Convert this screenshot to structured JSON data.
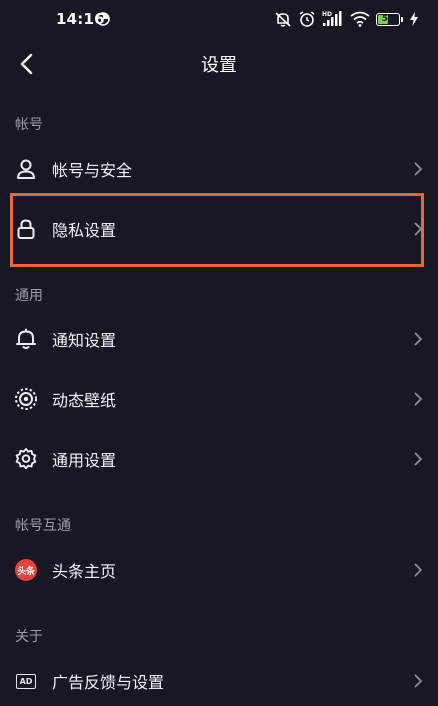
{
  "status_bar": {
    "time": "14:16",
    "battery_level": "51",
    "network_label": "HD"
  },
  "header": {
    "title": "设置"
  },
  "sections": {
    "account": {
      "header": "帐号",
      "items": [
        {
          "label": "帐号与安全"
        },
        {
          "label": "隐私设置"
        }
      ]
    },
    "general": {
      "header": "通用",
      "items": [
        {
          "label": "通知设置"
        },
        {
          "label": "动态壁纸"
        },
        {
          "label": "通用设置"
        }
      ]
    },
    "interop": {
      "header": "帐号互通",
      "items": [
        {
          "label": "头条主页",
          "logo_text": "头条"
        }
      ]
    },
    "about": {
      "header": "关于",
      "items": [
        {
          "label": "广告反馈与设置",
          "icon_text": "AD"
        }
      ]
    }
  },
  "colors": {
    "background": "#161824",
    "text": "#f2f3f7",
    "section_header": "#9a9ca6",
    "highlight": "#e9683a",
    "battery": "#7ad146",
    "toutiao_red": "#e8403a"
  },
  "icons": {
    "back": "chevron-left-icon",
    "account": "person-icon",
    "privacy": "lock-icon",
    "notification": "bell-icon",
    "wallpaper": "live-wallpaper-icon",
    "general": "gear-icon",
    "chevron": "chevron-right-icon"
  }
}
